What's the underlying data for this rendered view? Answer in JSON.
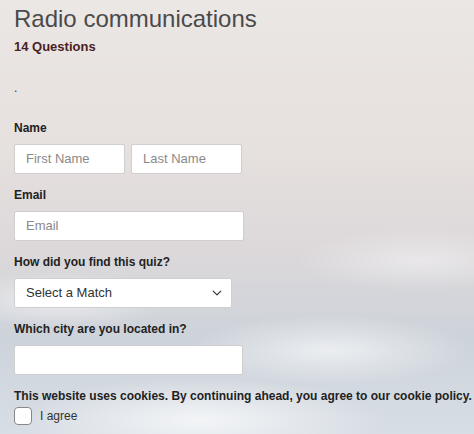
{
  "quiz": {
    "title": "Radio communications",
    "count": "14 Questions",
    "note": "."
  },
  "fields": [
    {
      "label": "Name",
      "kind": "text",
      "inputs": [
        {
          "placeholder": "First Name"
        },
        {
          "placeholder": "Last Name"
        }
      ]
    },
    {
      "label": "Email",
      "kind": "text",
      "inputs": [
        {
          "placeholder": "Email"
        }
      ]
    },
    {
      "label": "How did you find this quiz?",
      "kind": "select",
      "inputs": [
        {
          "value": "Select a Match"
        }
      ]
    },
    {
      "label": "Which city are you located in?",
      "kind": "text",
      "inputs": [
        {
          "value": ""
        }
      ]
    }
  ],
  "cookie": {
    "text": "This website uses cookies. By continuing ahead, you agree to our cookie policy.",
    "agree": {
      "label": "I agree",
      "checked": false
    }
  }
}
